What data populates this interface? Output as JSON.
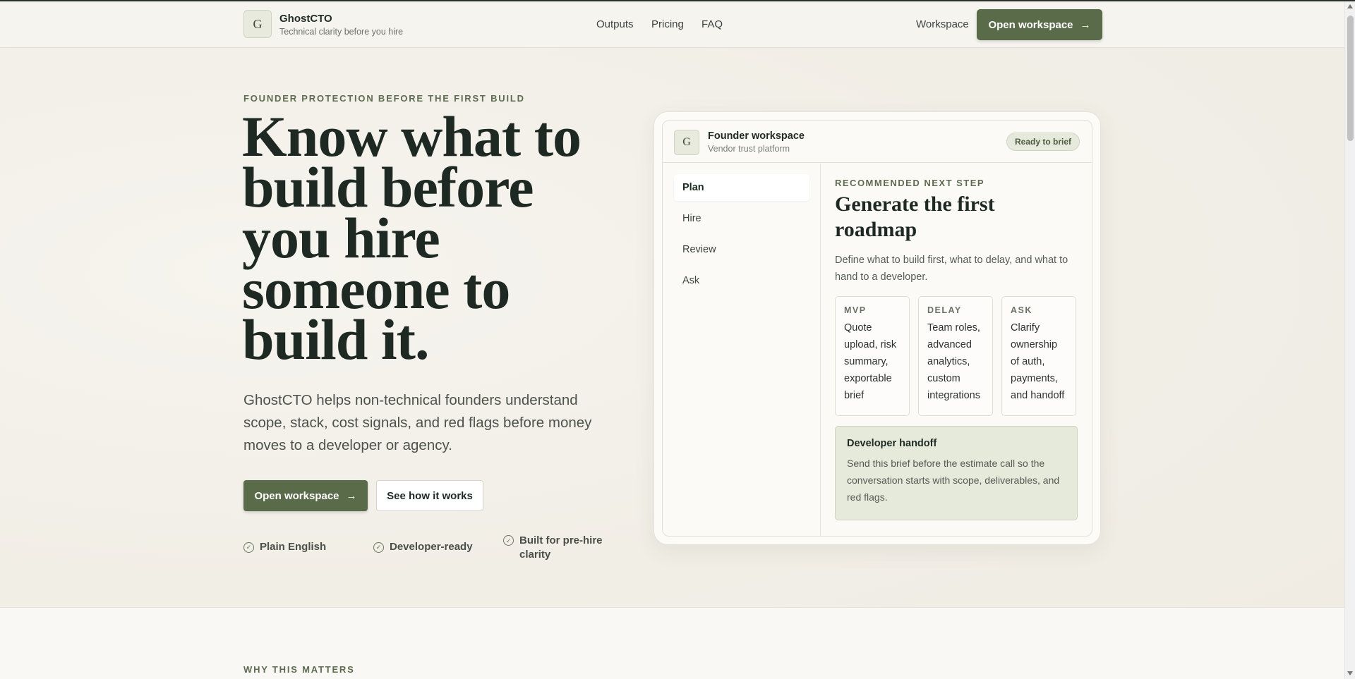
{
  "brand": {
    "logo_letter": "G",
    "name": "GhostCTO",
    "tagline": "Technical clarity before you hire"
  },
  "nav": {
    "outputs": "Outputs",
    "pricing": "Pricing",
    "faq": "FAQ",
    "workspace": "Workspace",
    "open_workspace": "Open workspace"
  },
  "hero": {
    "eyebrow": "FOUNDER PROTECTION BEFORE THE FIRST BUILD",
    "title": "Know what to build before you hire someone to build it.",
    "subtitle": "GhostCTO helps non-technical founders understand scope, stack, cost signals, and red flags before money moves to a developer or agency.",
    "primary_cta": "Open workspace",
    "secondary_cta": "See how it works",
    "checks": [
      "Plain English",
      "Developer-ready",
      "Built for pre-hire clarity"
    ]
  },
  "workspace": {
    "logo_letter": "G",
    "title": "Founder workspace",
    "subtitle": "Vendor trust platform",
    "badge": "Ready to brief",
    "sidebar": [
      "Plan",
      "Hire",
      "Review",
      "Ask"
    ],
    "eyebrow": "RECOMMENDED NEXT STEP",
    "heading": "Generate the first roadmap",
    "description": "Define what to build first, what to delay, and what to hand to a developer.",
    "cards": [
      {
        "label": "MVP",
        "text": "Quote upload, risk summary, exportable brief"
      },
      {
        "label": "DELAY",
        "text": "Team roles, advanced analytics, custom integrations"
      },
      {
        "label": "ASK",
        "text": "Clarify ownership of auth, payments, and handoff"
      }
    ],
    "handoff": {
      "title": "Developer handoff",
      "text": "Send this brief before the estimate call so the conversation starts with scope, deliverables, and red flags."
    }
  },
  "section2": {
    "eyebrow": "WHY THIS MATTERS"
  },
  "icons": {
    "arrow": "arrow-right-icon",
    "check": "check-circle-icon"
  },
  "colors": {
    "accent": "#596b48",
    "background": "#f5f3ec",
    "badge": "#e6eadc"
  }
}
